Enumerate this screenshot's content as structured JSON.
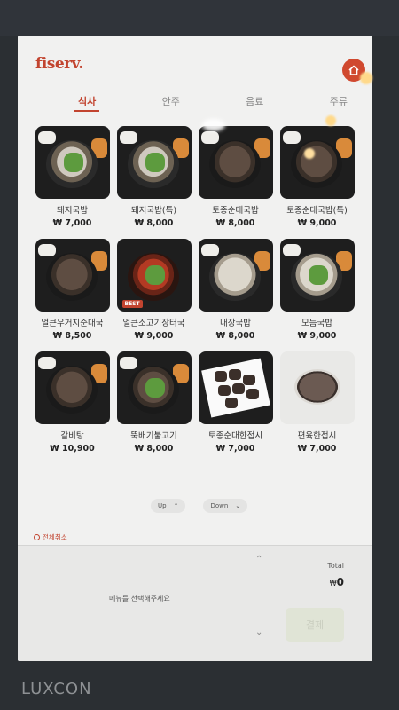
{
  "header": {
    "logo": "fiserv."
  },
  "tabs": [
    {
      "label": "식사",
      "active": true
    },
    {
      "label": "안주",
      "active": false
    },
    {
      "label": "음료",
      "active": false
    },
    {
      "label": "주류",
      "active": false
    }
  ],
  "menu": [
    {
      "name": "돼지국밥",
      "price": "₩ 7,000"
    },
    {
      "name": "돼지국밥(특)",
      "price": "₩ 8,000"
    },
    {
      "name": "토종순대국밥",
      "price": "₩ 8,000"
    },
    {
      "name": "토종순대국밥(특)",
      "price": "₩ 9,000"
    },
    {
      "name": "얼큰우거지순대국",
      "price": "₩ 8,500"
    },
    {
      "name": "얼큰소고기장터국",
      "price": "₩ 9,000",
      "badge": "BEST"
    },
    {
      "name": "내장국밥",
      "price": "₩ 8,000"
    },
    {
      "name": "모듬국밥",
      "price": "₩ 9,000"
    },
    {
      "name": "갈비탕",
      "price": "₩ 10,900"
    },
    {
      "name": "뚝배기불고기",
      "price": "₩ 8,000"
    },
    {
      "name": "토종순대한접시",
      "price": "₩ 7,000"
    },
    {
      "name": "편육한접시",
      "price": "₩ 7,000"
    }
  ],
  "pager": {
    "up": "Up",
    "down": "Down"
  },
  "order": {
    "clear_all": "전체취소",
    "empty_message": "메뉴를 선택해주세요",
    "total_label": "Total",
    "currency": "₩",
    "total_value": "0",
    "pay_label": "결제"
  },
  "device_brand": "LUXCON"
}
